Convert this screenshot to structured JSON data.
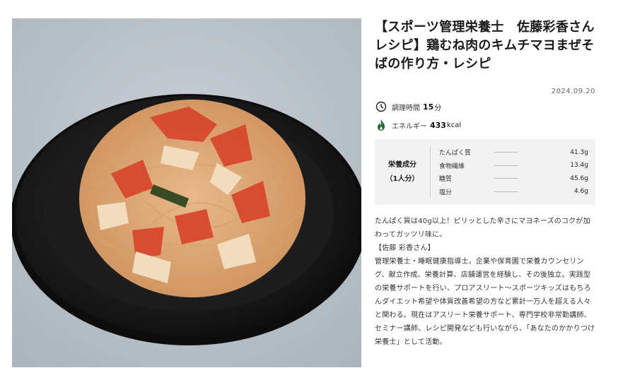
{
  "recipe": {
    "title": "【スポーツ管理栄養士　佐藤彩香さんレシピ】鶏むね肉のキムチマヨまぜそばの作り方・レシピ",
    "date": "2024.09.20",
    "cook_time": {
      "label": "調理時間",
      "value": "15",
      "unit": "分",
      "icon": "clock-icon"
    },
    "energy": {
      "label": "エネルギー",
      "value": "433",
      "unit": "kcal",
      "icon": "flame-icon"
    },
    "nutrition": {
      "heading": "栄養成分",
      "serving": "（1人分）",
      "items": [
        {
          "name": "たんぱく質",
          "value": "41.3g"
        },
        {
          "name": "食物繊維",
          "value": "13.4g"
        },
        {
          "name": "糖質",
          "value": "45.6g"
        },
        {
          "name": "塩分",
          "value": "4.6g"
        }
      ]
    },
    "description": {
      "intro": "たんぱく質は40g以上！ピリッとした辛さにマヨネーズのコクが加わってガッツリ味に。",
      "author_heading": "【佐藤 彩香さん】",
      "bio": "管理栄養士・睡眠健康指導士。企業や保育園で栄養カウンセリング、献立作成、栄養計算、店舗運営を経験し、その後独立。実践型の栄養サポートを行い、プロアスリート〜スポーツキッズはもちろんダイエット希望や体質改善希望の方など累計一万人を超える人々と関わる。現在はアスリート栄養サポート、専門学校非常勤講師、セミナー講師、レシピ開発なども行いながら、「あなたのかかりつけ栄養士」として活動。"
    },
    "colors": {
      "accent": "#2e6b3a",
      "panel": "#f2f2f2"
    }
  }
}
